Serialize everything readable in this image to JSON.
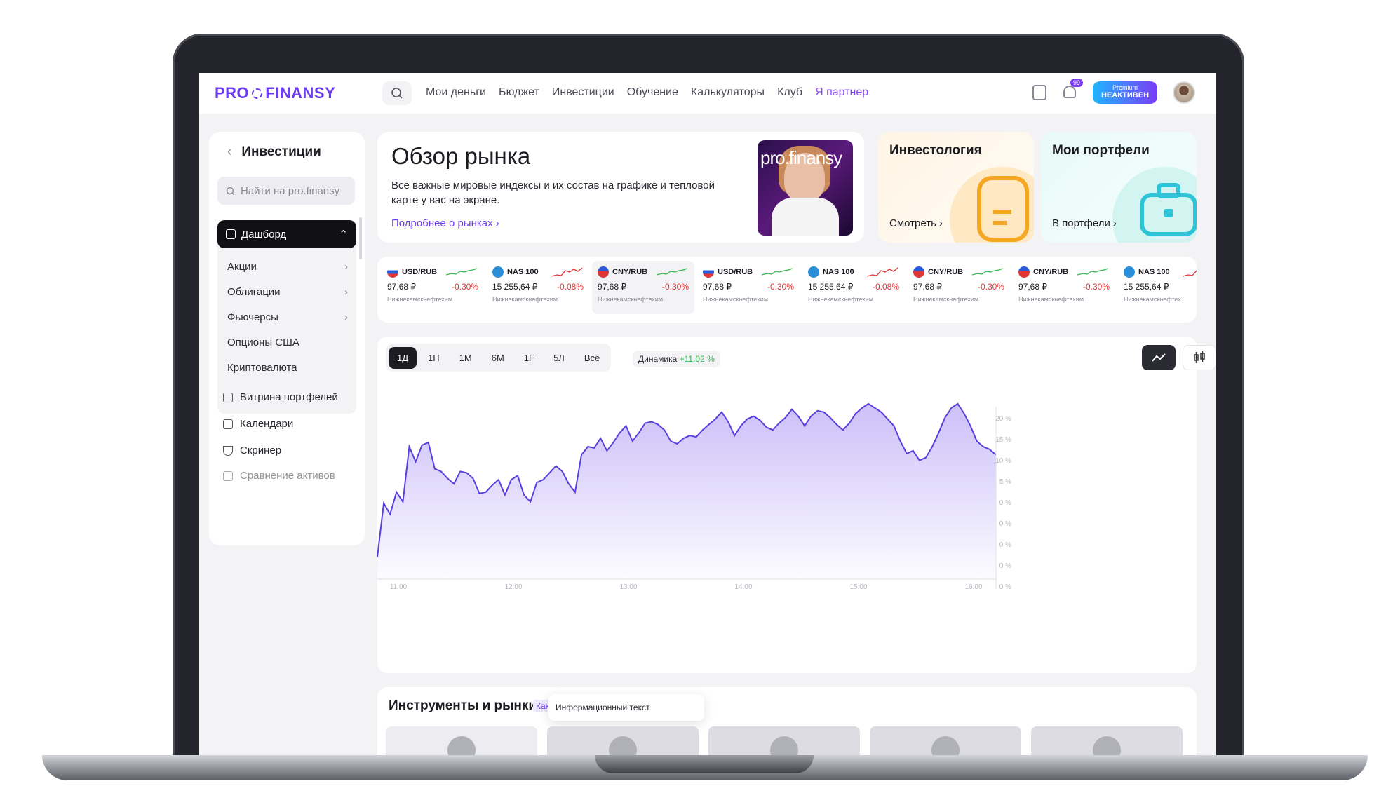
{
  "brand": {
    "logo_left": "PRO",
    "logo_right": "FINANSY",
    "accent": "#6d3cf5"
  },
  "nav": [
    "Мои деньги",
    "Бюджет",
    "Инвестиции",
    "Обучение",
    "Калькуляторы",
    "Клуб",
    "Я партнер"
  ],
  "header": {
    "notif_count": "99",
    "premium_label": "Premium",
    "premium_status": "НЕАКТИВЕН"
  },
  "sidebar": {
    "title": "Инвестиции",
    "search_placeholder": "Найти на pro.finansy",
    "active": "Дашборд",
    "items": [
      "Акции",
      "Облигации",
      "Фьючерсы",
      "Опционы США",
      "Криптовалюта"
    ],
    "links": [
      "Витрина портфелей",
      "Календари",
      "Скринер",
      "Сравнение активов"
    ]
  },
  "overview": {
    "title": "Обзор рынка",
    "desc": "Все важные мировые индексы и их состав на графике и тепловой карте у вас на экране.",
    "more": "Подробнее о рынках",
    "video_text": "pro.finansy"
  },
  "cards": {
    "investology": {
      "title": "Инвестология",
      "link": "Смотреть"
    },
    "portfolios": {
      "title": "Мои портфели",
      "link": "В портфели"
    }
  },
  "tickers": [
    {
      "sym": "USD/RUB",
      "price": "97,68 ₽",
      "chg": "-0.30%",
      "sub": "Нижнекамскнефтехим",
      "flag": "ru",
      "spark": "green"
    },
    {
      "sym": "NAS 100",
      "price": "15 255,64 ₽",
      "chg": "-0.08%",
      "sub": "Нижнекамскнефтехим",
      "flag": "nas",
      "spark": "red"
    },
    {
      "sym": "CNY/RUB",
      "price": "97,68 ₽",
      "chg": "-0.30%",
      "sub": "Нижнекамскнефтехим",
      "flag": "cn",
      "spark": "green"
    },
    {
      "sym": "USD/RUB",
      "price": "97,68 ₽",
      "chg": "-0.30%",
      "sub": "Нижнекамскнефтехим",
      "flag": "ru",
      "spark": "green"
    },
    {
      "sym": "NAS 100",
      "price": "15 255,64 ₽",
      "chg": "-0.08%",
      "sub": "Нижнекамскнефтехим",
      "flag": "nas",
      "spark": "red"
    },
    {
      "sym": "CNY/RUB",
      "price": "97,68 ₽",
      "chg": "-0.30%",
      "sub": "Нижнекамскнефтехим",
      "flag": "cn",
      "spark": "green"
    },
    {
      "sym": "CNY/RUB",
      "price": "97,68 ₽",
      "chg": "-0.30%",
      "sub": "Нижнекамскнефтехим",
      "flag": "cn",
      "spark": "green"
    },
    {
      "sym": "NAS 100",
      "price": "15 255,64 ₽",
      "chg": "",
      "sub": "Нижнекамскнефтех",
      "flag": "nas",
      "spark": "red"
    }
  ],
  "chart": {
    "periods": [
      "1Д",
      "1Н",
      "1М",
      "6М",
      "1Г",
      "5Л",
      "Все"
    ],
    "active_period": "1Д",
    "dynamics_label": "Динамика",
    "dynamics_value": "+11.02 %"
  },
  "chart_data": {
    "type": "area",
    "x_ticks": [
      "11:00",
      "12:00",
      "13:00",
      "14:00",
      "15:00",
      "16:00"
    ],
    "y_ticks": [
      "20 %",
      "15 %",
      "10 %",
      "5 %",
      "0 %",
      "0 %",
      "0 %",
      "0 %",
      "0 %"
    ],
    "series": [
      {
        "values": [
          16,
          55,
          47,
          63,
          56,
          96,
          85,
          97,
          99,
          80,
          78,
          73,
          69,
          78,
          77,
          73,
          62,
          63,
          68,
          72,
          61,
          72,
          75,
          61,
          56,
          70,
          72,
          77,
          82,
          78,
          69,
          63,
          90,
          96,
          95,
          102,
          93,
          99,
          106,
          111,
          100,
          106,
          113,
          114,
          112,
          108,
          100,
          98,
          102,
          104,
          103,
          108,
          112,
          116,
          121,
          114,
          104,
          111,
          116,
          118,
          115,
          110,
          108,
          113,
          117,
          123,
          118,
          111,
          118,
          122,
          121,
          117,
          112,
          108,
          113,
          120,
          124,
          127,
          124,
          121,
          116,
          111,
          100,
          91,
          93,
          86,
          88,
          96,
          106,
          117,
          124,
          127,
          120,
          111,
          100,
          96,
          94,
          90
        ]
      }
    ],
    "fill_color": "#c9bcf8",
    "line_color": "#5a3fdc"
  },
  "instruments": {
    "title": "Инструменты и рынки",
    "hint": "Как",
    "tooltip": "Информационный текст"
  }
}
